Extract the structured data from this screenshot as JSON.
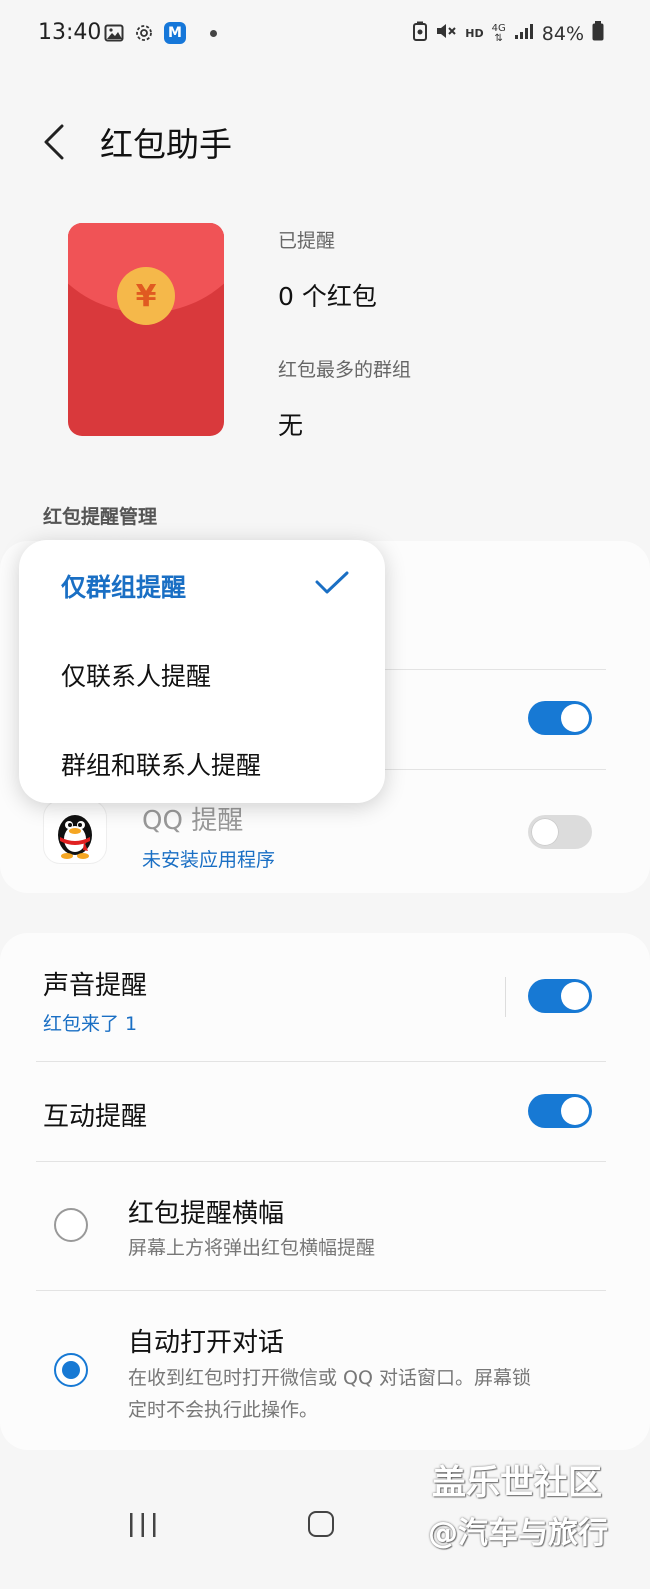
{
  "status_bar": {
    "time": "13:40",
    "hd_label": "HD",
    "network_label": "4G",
    "battery": "84%"
  },
  "header": {
    "title": "红包助手"
  },
  "stats": {
    "reminded_label": "已提醒",
    "reminded_value": "0 个红包",
    "top_group_label": "红包最多的群组",
    "top_group_value": "无",
    "envelope_symbol": "¥"
  },
  "section_heading": "红包提醒管理",
  "popup_menu": {
    "items": [
      {
        "label": "仅群组提醒",
        "selected": true
      },
      {
        "label": "仅联系人提醒",
        "selected": false
      },
      {
        "label": "群组和联系人提醒",
        "selected": false
      }
    ]
  },
  "apps": {
    "wechat": {
      "enabled": true
    },
    "qq": {
      "title": "QQ 提醒",
      "subtitle": "未安装应用程序",
      "enabled": false
    }
  },
  "settings": {
    "sound": {
      "title": "声音提醒",
      "subtitle": "红包来了 1",
      "enabled": true
    },
    "interactive": {
      "title": "互动提醒",
      "enabled": true
    },
    "banner": {
      "title": "红包提醒横幅",
      "desc": "屏幕上方将弹出红包横幅提醒",
      "selected": false
    },
    "auto_open": {
      "title": "自动打开对话",
      "desc_line1": "在收到红包时打开微信或 QQ 对话窗口。屏幕锁",
      "desc_line2": "定时不会执行此操作。",
      "selected": true
    }
  },
  "watermark": {
    "line1": "盖乐世社区",
    "line2": "@汽车与旅行"
  },
  "colors": {
    "accent": "#1779d4",
    "envelope": "#d9393c",
    "coin": "#f5b84a"
  }
}
